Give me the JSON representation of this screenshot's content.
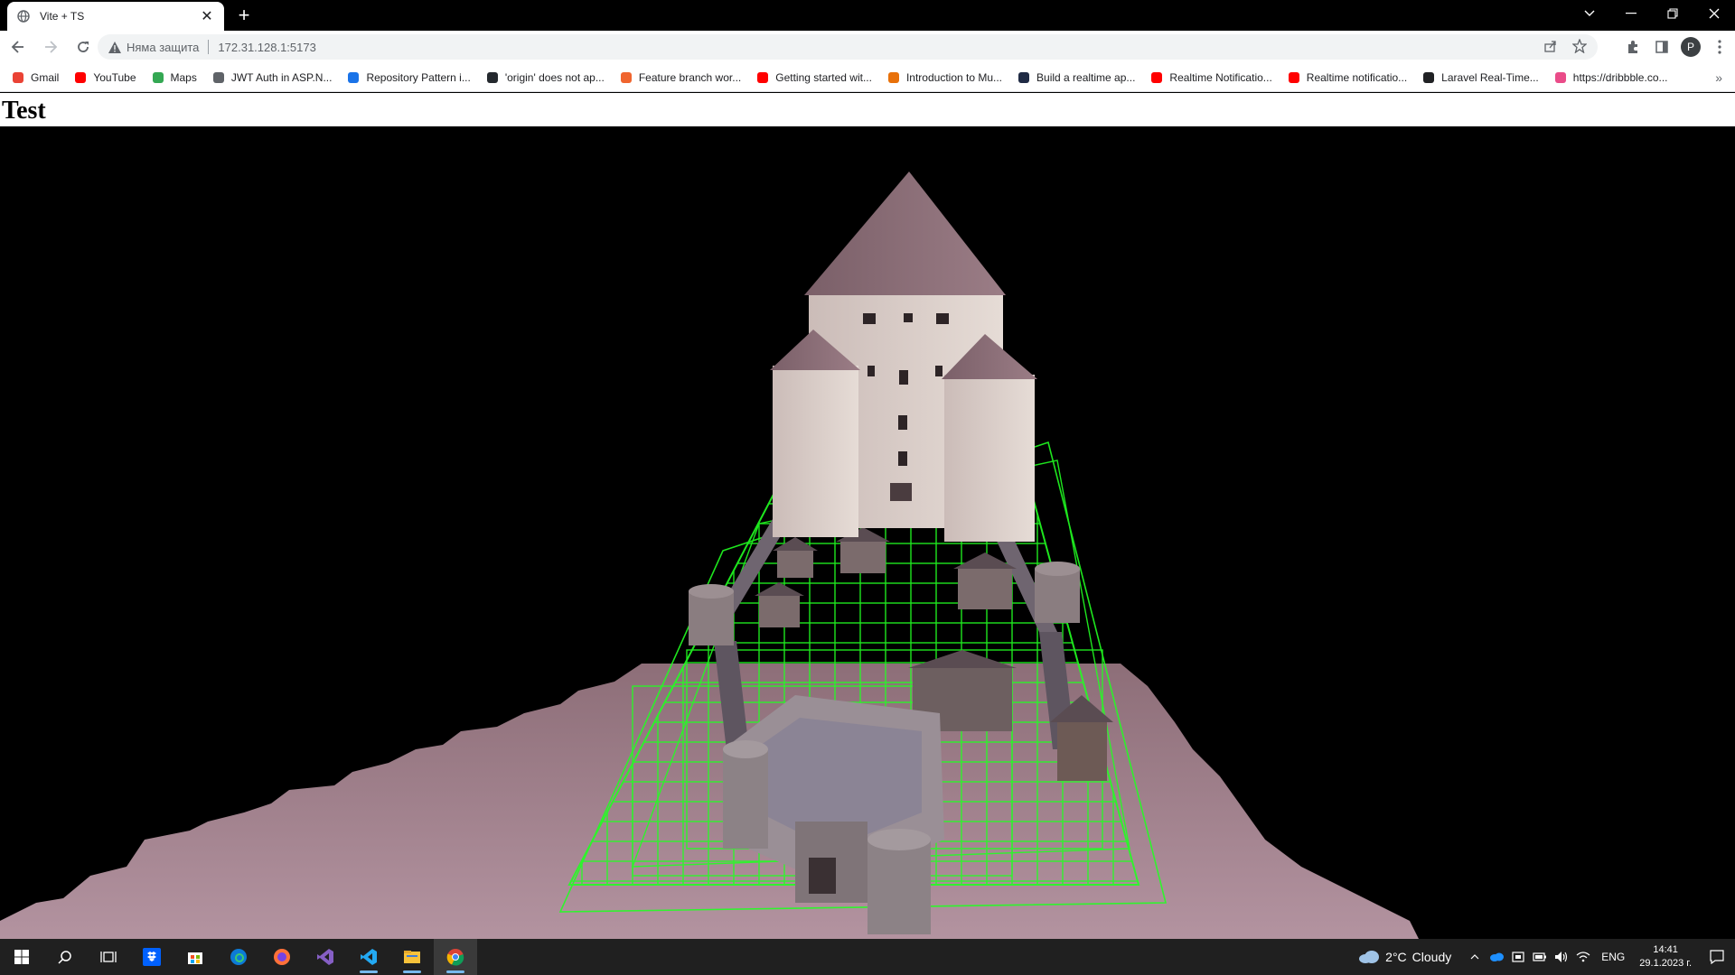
{
  "browser": {
    "tab": {
      "title": "Vite + TS",
      "favicon": "globe-icon"
    },
    "address_bar": {
      "security_text": "Няма защита",
      "url": "172.31.128.1:5173"
    },
    "profile_initial": "P",
    "bookmarks": [
      {
        "label": "Gmail",
        "icon": "gmail-icon",
        "color": "#ea4335"
      },
      {
        "label": "YouTube",
        "icon": "youtube-icon",
        "color": "#ff0000"
      },
      {
        "label": "Maps",
        "icon": "maps-icon",
        "color": "#34a853"
      },
      {
        "label": "JWT Auth in ASP.N...",
        "icon": "jwt-icon",
        "color": "#5f6368"
      },
      {
        "label": "Repository Pattern i...",
        "icon": "bookmark-site-icon",
        "color": "#1a73e8"
      },
      {
        "label": "'origin' does not ap...",
        "icon": "github-icon",
        "color": "#24292e"
      },
      {
        "label": "Feature branch wor...",
        "icon": "bitbucket-icon",
        "color": "#f0652f"
      },
      {
        "label": "Getting started wit...",
        "icon": "youtube-icon",
        "color": "#ff0000"
      },
      {
        "label": "Introduction to Mu...",
        "icon": "bookmark-site-icon",
        "color": "#e8710a"
      },
      {
        "label": "Build a realtime ap...",
        "icon": "bookmark-site-icon",
        "color": "#1f2a44"
      },
      {
        "label": "Realtime Notificatio...",
        "icon": "youtube-icon",
        "color": "#ff0000"
      },
      {
        "label": "Realtime notificatio...",
        "icon": "youtube-icon",
        "color": "#ff0000"
      },
      {
        "label": "Laravel Real-Time...",
        "icon": "bookmark-site-icon",
        "color": "#202124"
      },
      {
        "label": "https://dribbble.co...",
        "icon": "dribbble-icon",
        "color": "#ea4c89"
      }
    ]
  },
  "page": {
    "title": "Test"
  },
  "taskbar": {
    "apps": [
      {
        "name": "start-button",
        "icon": "windows-icon"
      },
      {
        "name": "search-button",
        "icon": "search-icon"
      },
      {
        "name": "task-view-button",
        "icon": "task-view-icon"
      },
      {
        "name": "dropbox-app",
        "icon": "dropbox-icon"
      },
      {
        "name": "store-app",
        "icon": "store-icon"
      },
      {
        "name": "edge-app",
        "icon": "edge-icon"
      },
      {
        "name": "firefox-app",
        "icon": "firefox-icon"
      },
      {
        "name": "visual-studio-app",
        "icon": "visual-studio-icon"
      },
      {
        "name": "vscode-app",
        "icon": "vscode-icon"
      },
      {
        "name": "file-explorer-app",
        "icon": "folder-icon"
      },
      {
        "name": "chrome-app",
        "icon": "chrome-icon"
      }
    ],
    "weather": {
      "temp": "2°C",
      "condition": "Cloudy"
    },
    "language": "ENG",
    "time": "14:41",
    "date": "29.1.2023 г."
  },
  "colors": {
    "wireframe": "#22ff22",
    "ground": "#a07f88",
    "accent": "#76b9ed"
  }
}
